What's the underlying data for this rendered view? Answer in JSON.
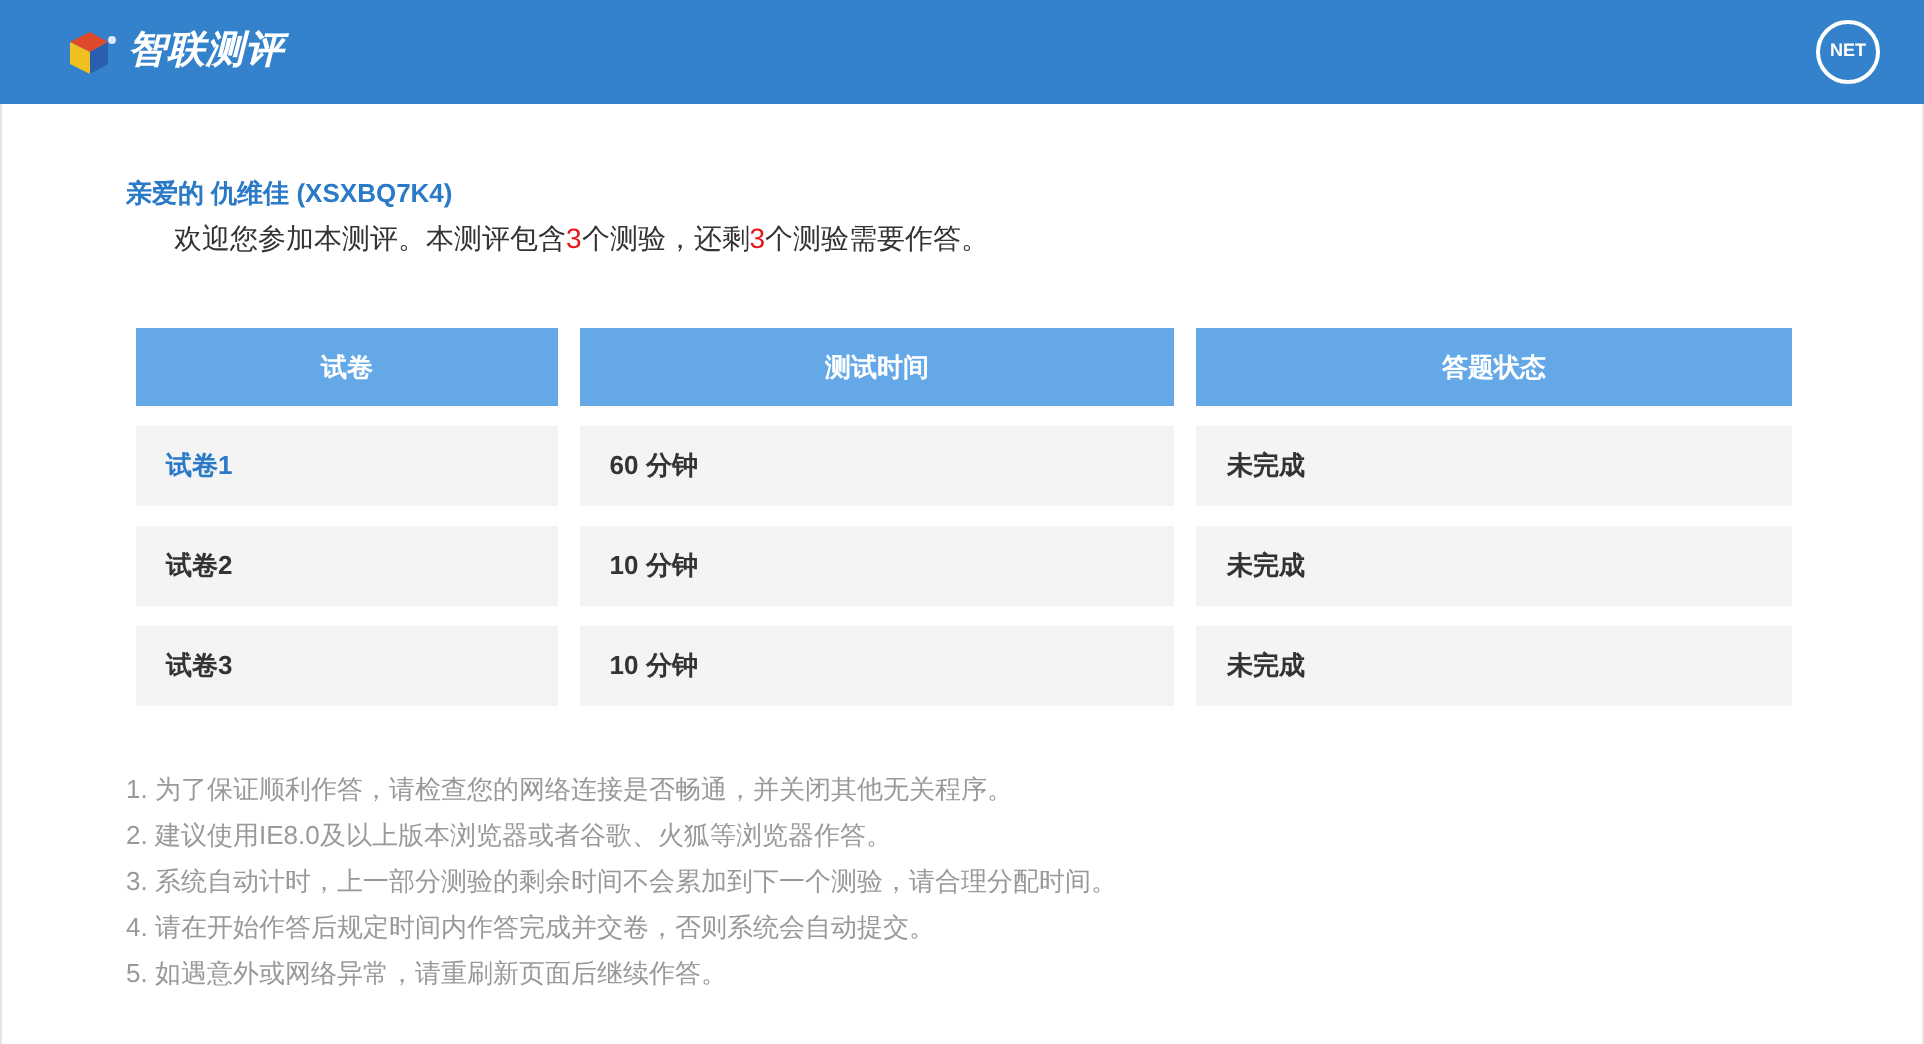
{
  "header": {
    "brand": "智联测评",
    "badge": "NET"
  },
  "greeting": "亲爱的 仇维佳 (XSXBQ7K4)",
  "welcome": [
    {
      "text": "欢迎您参加本测评。本测评包含",
      "highlight": false
    },
    {
      "text": "3",
      "highlight": true
    },
    {
      "text": "个测验，还剩",
      "highlight": false
    },
    {
      "text": "3",
      "highlight": true
    },
    {
      "text": "个测验需要作答。",
      "highlight": false
    }
  ],
  "table": {
    "columns": [
      "试卷",
      "测试时间",
      "答题状态"
    ],
    "rows": [
      {
        "paper": "试卷1",
        "time": "60 分钟",
        "status": "未完成",
        "link": true
      },
      {
        "paper": "试卷2",
        "time": "10 分钟",
        "status": "未完成",
        "link": false
      },
      {
        "paper": "试卷3",
        "time": "10 分钟",
        "status": "未完成",
        "link": false
      }
    ]
  },
  "notes": [
    "1. 为了保证顺利作答，请检查您的网络连接是否畅通，并关闭其他无关程序。",
    "2. 建议使用IE8.0及以上版本浏览器或者谷歌、火狐等浏览器作答。",
    "3. 系统自动计时，上一部分测验的剩余时间不会累加到下一个测验，请合理分配时间。",
    "4. 请在开始作答后规定时间内作答完成并交卷，否则系统会自动提交。",
    "5. 如遇意外或网络异常，请重刷新页面后继续作答。"
  ]
}
